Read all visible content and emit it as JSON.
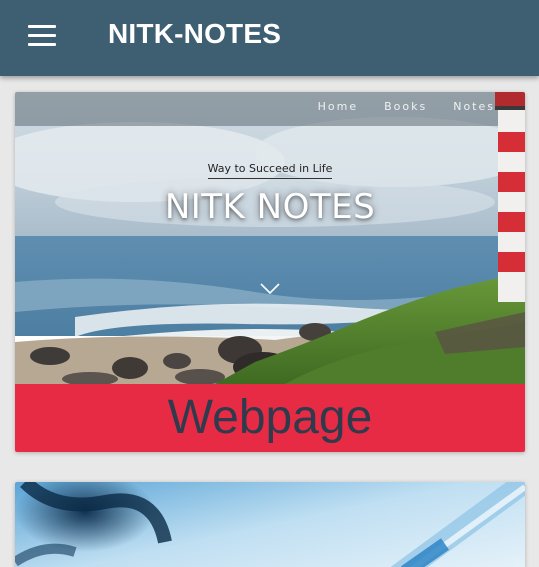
{
  "appbar": {
    "title": "NITK-NOTES",
    "menu_icon": "hamburger-menu-icon",
    "background": "#3e5f72"
  },
  "cards": [
    {
      "hero": {
        "nav": [
          "Home",
          "Books",
          "Notes"
        ],
        "tagline": "Way to Succeed in Life",
        "title": "NITK NOTES",
        "chevron_icon": "chevron-down-icon"
      },
      "label": "Webpage",
      "label_color": "#e82b45"
    },
    {
      "image": "laboratory-pipette-image"
    }
  ]
}
